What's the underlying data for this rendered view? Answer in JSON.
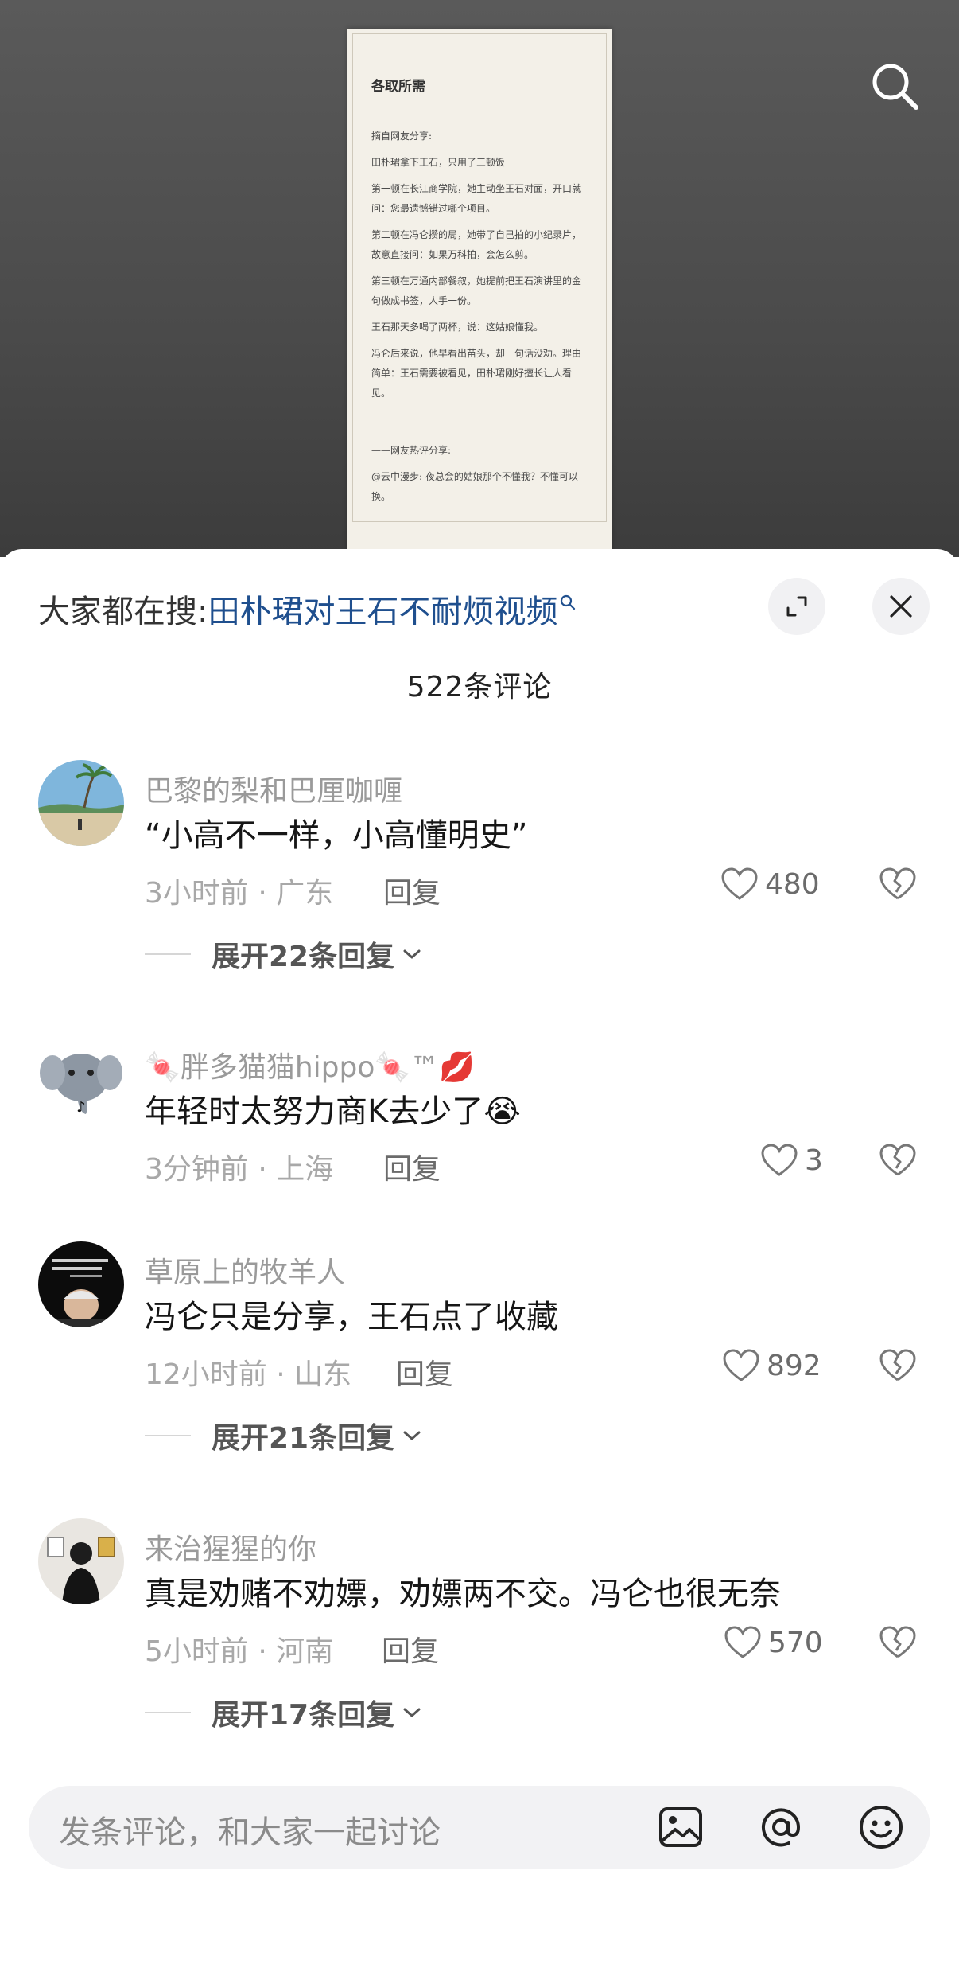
{
  "paper": {
    "title": "各取所需",
    "paragraphs": [
      "摘自网友分享:",
      "田朴珺拿下王石，只用了三顿饭",
      "第一顿在长江商学院，她主动坐王石对面，开口就问：您最遗憾错过哪个项目。",
      "第二顿在冯仑攒的局，她带了自己拍的小纪录片，故意直接问：如果万科拍，会怎么剪。",
      "第三顿在万通内部餐叙，她提前把王石演讲里的金句做成书签，人手一份。",
      "王石那天多喝了两杯，说：这姑娘懂我。",
      "冯仑后来说，他早看出苗头，却一句话没劝。理由简单：王石需要被看见，田朴珺刚好擅长让人看见。"
    ],
    "footer_heading": "——网友热评分享:",
    "footer_text": "@云中漫步: 夜总会的姑娘那个不懂我？不懂可以换。"
  },
  "hot_search": {
    "prefix": "大家都在搜:",
    "query": "田朴珺对王石不耐烦视频"
  },
  "comment_count": "522条评论",
  "comments": [
    {
      "user": "巴黎的梨和巴厘咖喱",
      "text": "“小高不一样，小高懂明史”",
      "time_location": "3小时前 · 广东",
      "reply_label": "回复",
      "likes": "480",
      "expand": "展开22条回复"
    },
    {
      "user": "🍬胖多猫猫hippo🍬™💋",
      "text": "年轻时太努力商K去少了😭",
      "time_location": "3分钟前 · 上海",
      "reply_label": "回复",
      "likes": "3",
      "expand": ""
    },
    {
      "user": "草原上的牧羊人",
      "text": "冯仑只是分享，王石点了收藏",
      "time_location": "12小时前 · 山东",
      "reply_label": "回复",
      "likes": "892",
      "expand": "展开21条回复"
    },
    {
      "user": "来治猩猩的你",
      "text": "真是劝赌不劝嫖，劝嫖两不交。冯仑也很无奈",
      "time_location": "5小时前 · 河南",
      "reply_label": "回复",
      "likes": "570",
      "expand": "展开17条回复"
    }
  ],
  "input": {
    "placeholder": "发条评论，和大家一起讨论"
  },
  "icons": {
    "top_search": "search-icon",
    "expand": "expand-icon",
    "close": "close-icon",
    "like": "heart-icon",
    "dislike": "broken-heart-icon",
    "image": "image-icon",
    "mention": "at-icon",
    "emoji": "emoji-icon"
  }
}
